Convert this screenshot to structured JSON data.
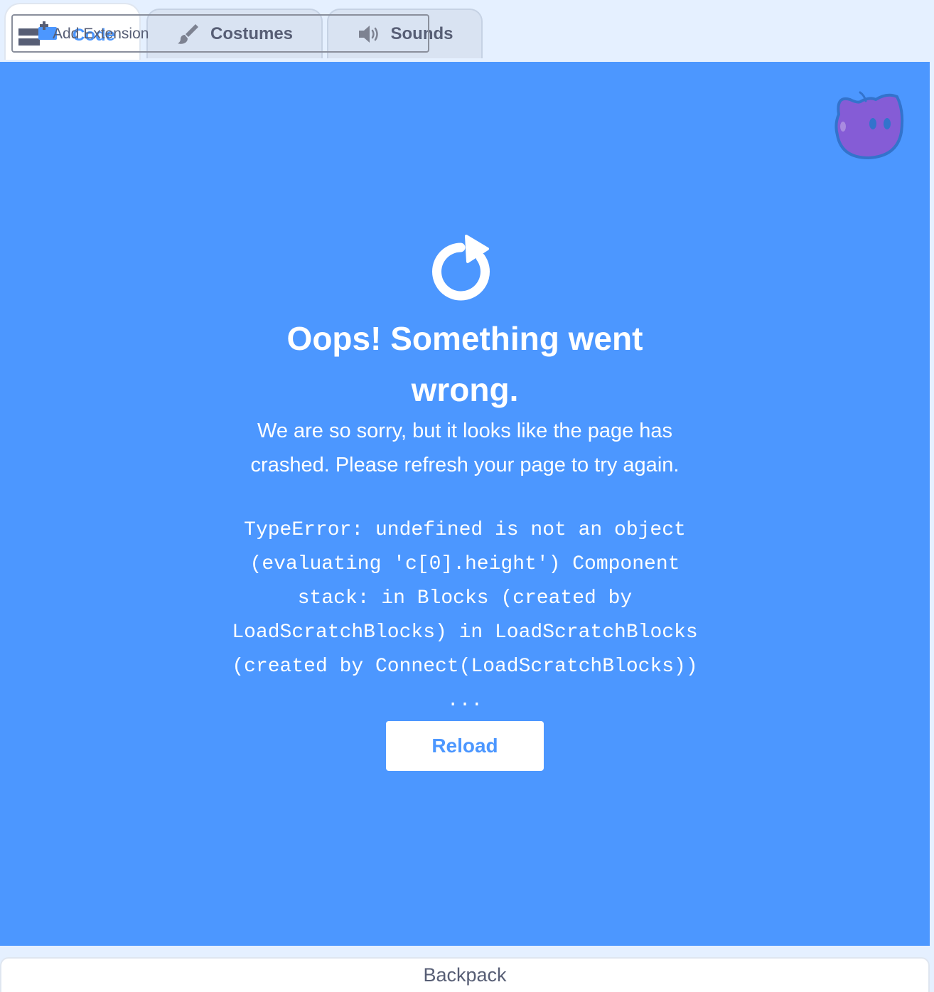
{
  "tabs": {
    "code_label": "Code",
    "costumes_label": "Costumes",
    "sounds_label": "Sounds",
    "add_extension_label": "Add Extension"
  },
  "crash": {
    "title": "Oops! Something went wrong.",
    "message": "We are so sorry, but it looks like the page has crashed. Please refresh your page to try again.",
    "error": "TypeError: undefined is not an object (evaluating 'c[0].height') Component stack: in Blocks (created by LoadScratchBlocks) in LoadScratchBlocks (created by Connect(LoadScratchBlocks)) ...",
    "reload_label": "Reload"
  },
  "backpack": {
    "label": "Backpack"
  },
  "colors": {
    "crash_background": "#4c97ff",
    "accent": "#4c97ff",
    "tabbar_background": "#e5f0ff",
    "text_gray": "#575e75",
    "mascot_purple": "#855cd6"
  },
  "icons": {
    "code": "code-blocks-icon",
    "costumes": "paintbrush-icon",
    "sounds": "speaker-icon",
    "extension": "add-extension-icon",
    "reload": "reload-icon",
    "mascot": "crashed-cat-icon"
  }
}
